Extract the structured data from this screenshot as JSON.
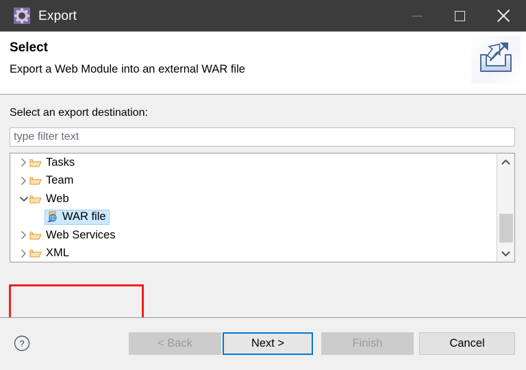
{
  "window": {
    "title": "Export",
    "icon": "export-wizard-gear-icon",
    "controls": {
      "minimize": "minimize-icon",
      "maximize": "maximize-icon",
      "close": "close-icon"
    }
  },
  "header": {
    "title": "Select",
    "description": "Export a Web Module into an external WAR file",
    "icon": "export-banner-icon"
  },
  "body": {
    "destination_label": "Select an export destination:",
    "filter": {
      "value": "",
      "placeholder": "type filter text"
    },
    "tree": [
      {
        "label": "Tasks",
        "type": "folder",
        "expanded": false,
        "indent": 0,
        "selected": false
      },
      {
        "label": "Team",
        "type": "folder",
        "expanded": false,
        "indent": 0,
        "selected": false
      },
      {
        "label": "Web",
        "type": "folder",
        "expanded": true,
        "indent": 0,
        "selected": false
      },
      {
        "label": "WAR file",
        "type": "war",
        "expanded": null,
        "indent": 1,
        "selected": true
      },
      {
        "label": "Web Services",
        "type": "folder",
        "expanded": false,
        "indent": 0,
        "selected": false
      },
      {
        "label": "XML",
        "type": "folder",
        "expanded": false,
        "indent": 0,
        "selected": false
      }
    ],
    "scrollbar": {
      "up_arrow": "chevron-up-icon",
      "down_arrow": "chevron-down-icon"
    },
    "annotation": {
      "color": "#f21f1f",
      "targets": "Web / WAR file"
    }
  },
  "footer": {
    "help": "?",
    "buttons": [
      {
        "label": "< Back",
        "state": "disabled"
      },
      {
        "label": "Next >",
        "state": "focused"
      },
      {
        "label": "Finish",
        "state": "disabled"
      },
      {
        "label": "Cancel",
        "state": "enabled"
      }
    ]
  },
  "colors": {
    "titlebar": "#3c3c3c",
    "accent_focus": "#0078d7",
    "selection": "#cde8ff",
    "annotation": "#f21f1f",
    "body": "#f0f0f0"
  }
}
